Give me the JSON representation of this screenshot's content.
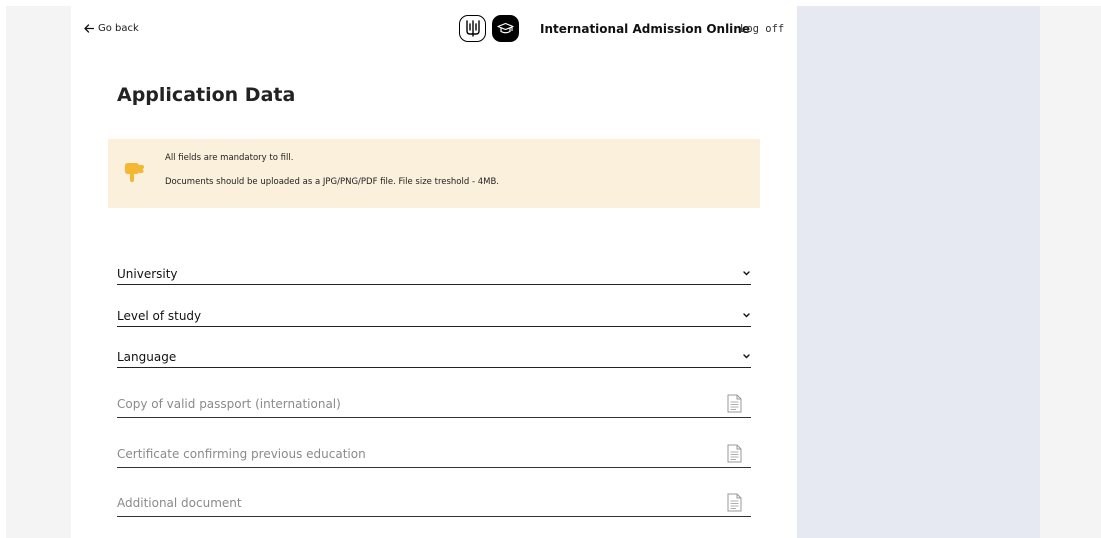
{
  "header": {
    "back_label": "Go back",
    "app_title": "International Admission Online",
    "logoff_label": "Log off"
  },
  "page": {
    "title": "Application Data"
  },
  "notice": {
    "icon": "pointing-down-hand-icon",
    "line1": "All fields are mandatory to fill.",
    "line2": "Documents should be uploaded as a JPG/PNG/PDF file. File size treshold - 4MB."
  },
  "selects": [
    {
      "label": "University"
    },
    {
      "label": "Level of study"
    },
    {
      "label": "Language"
    }
  ],
  "uploads": [
    {
      "placeholder": "Copy of valid passport (international)"
    },
    {
      "placeholder": "Certificate confirming previous education"
    },
    {
      "placeholder": "Additional document"
    }
  ],
  "colors": {
    "notice_bg": "#faf0dc",
    "notice_icon": "#f5b731",
    "side_panel": "#e6e9f1",
    "outer_bg": "#f4f4f5"
  }
}
